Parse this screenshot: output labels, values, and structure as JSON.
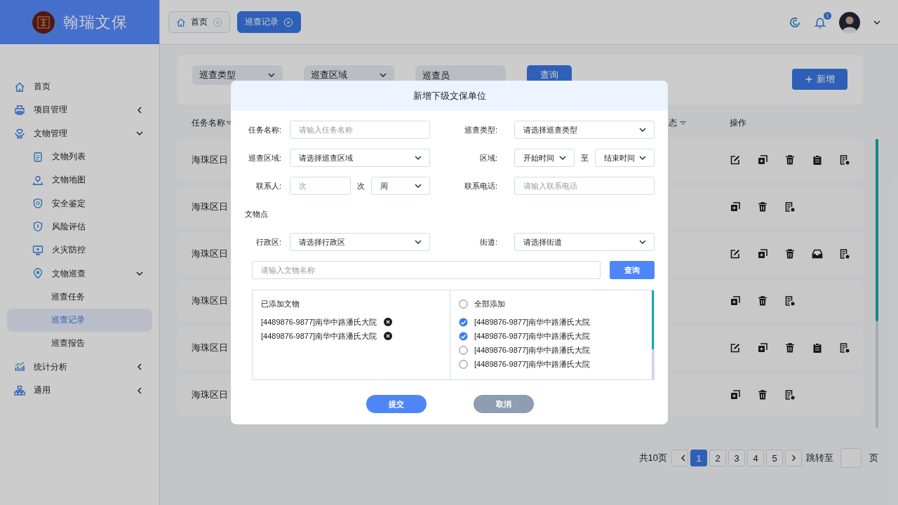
{
  "brand": {
    "name": "翰瑞文保"
  },
  "sidebar": {
    "items": [
      {
        "label": "首页",
        "selected": false
      },
      {
        "label": "项目管理",
        "selected": false,
        "expanded": false
      },
      {
        "label": "文物管理",
        "selected": false,
        "expanded": true,
        "children": [
          {
            "label": "文物列表",
            "selected": false
          },
          {
            "label": "文物地图",
            "selected": false
          },
          {
            "label": "安全鉴定",
            "selected": false
          },
          {
            "label": "风险评估",
            "selected": false
          },
          {
            "label": "火灾防控",
            "selected": false
          },
          {
            "label": "文物巡查",
            "selected": false,
            "expanded": true,
            "children": [
              {
                "label": "巡查任务",
                "selected": false
              },
              {
                "label": "巡查记录",
                "selected": true
              },
              {
                "label": "巡查报告",
                "selected": false
              }
            ]
          }
        ]
      },
      {
        "label": "统计分析",
        "selected": false,
        "expanded": false
      },
      {
        "label": "通用",
        "selected": false,
        "expanded": false
      }
    ]
  },
  "tabs": [
    {
      "label": "首页",
      "selected": false
    },
    {
      "label": "巡查记录",
      "selected": true
    }
  ],
  "header": {
    "notification_count": "1"
  },
  "filters": [
    {
      "kind": "select",
      "label": "巡查类型"
    },
    {
      "kind": "select",
      "label": "巡查区域"
    },
    {
      "kind": "input",
      "placeholder": "巡查员"
    }
  ],
  "query_button": "查询",
  "add_button": "新增",
  "table": {
    "columns": [
      {
        "label": "任务名称",
        "sortable": true
      },
      {
        "label": "态",
        "sortable": true
      },
      {
        "label": "操作",
        "sortable": false
      }
    ],
    "rows": [
      {
        "task_name": "海珠区日",
        "actions": [
          {
            "kind": "edit"
          },
          {
            "kind": "copy"
          },
          {
            "kind": "delete"
          },
          {
            "kind": "clipboard"
          },
          {
            "kind": "report"
          }
        ]
      },
      {
        "task_name": "海珠区日",
        "actions": [
          {
            "kind": "copy"
          },
          {
            "kind": "delete"
          },
          {
            "kind": "report"
          }
        ]
      },
      {
        "task_name": "海珠区日",
        "actions": [
          {
            "kind": "edit"
          },
          {
            "kind": "copy"
          },
          {
            "kind": "delete"
          },
          {
            "kind": "inbox"
          },
          {
            "kind": "report"
          }
        ]
      },
      {
        "task_name": "海珠区日",
        "actions": [
          {
            "kind": "copy"
          },
          {
            "kind": "delete"
          },
          {
            "kind": "report"
          }
        ]
      },
      {
        "task_name": "海珠区日",
        "actions": [
          {
            "kind": "edit"
          },
          {
            "kind": "copy"
          },
          {
            "kind": "delete"
          },
          {
            "kind": "clipboard"
          },
          {
            "kind": "report"
          }
        ]
      },
      {
        "task_name": "海珠区日",
        "actions": [
          {
            "kind": "copy"
          },
          {
            "kind": "delete"
          },
          {
            "kind": "report"
          }
        ]
      }
    ]
  },
  "pagination": {
    "total": "共10页",
    "pages": [
      {
        "label": "1",
        "selected": true
      },
      {
        "label": "2",
        "selected": false
      },
      {
        "label": "3",
        "selected": false
      },
      {
        "label": "4",
        "selected": false
      },
      {
        "label": "5",
        "selected": false
      }
    ],
    "jump_label": "跳转至",
    "suffix": "页"
  },
  "dialog": {
    "title": "新增下级文保单位",
    "form_rows": [
      {
        "kind": "fields",
        "fields": [
          {
            "label": "任务名称:",
            "controls": [
              {
                "kind": "input",
                "placeholder": "请输入任务名称"
              }
            ]
          },
          {
            "label": "巡查类型:",
            "controls": [
              {
                "kind": "select",
                "value": "请选择巡查类型"
              }
            ]
          }
        ]
      },
      {
        "kind": "fields",
        "fields": [
          {
            "label": "巡查区域:",
            "controls": [
              {
                "kind": "select",
                "value": "请选择巡查区域"
              }
            ]
          },
          {
            "label": "区域:",
            "controls": [
              {
                "kind": "select",
                "value": "开始时间"
              },
              {
                "kind": "text",
                "text": "至"
              },
              {
                "kind": "select",
                "value": "结束时间"
              }
            ]
          }
        ]
      },
      {
        "kind": "fields",
        "fields": [
          {
            "label": "联系人:",
            "controls": [
              {
                "kind": "input",
                "placeholder": "次"
              },
              {
                "kind": "text",
                "text": "次"
              },
              {
                "kind": "select",
                "value": "周"
              }
            ]
          },
          {
            "label": "联系电话:",
            "controls": [
              {
                "kind": "input",
                "placeholder": "请输入联系电话"
              }
            ]
          }
        ]
      },
      {
        "kind": "section",
        "title": "文物点"
      },
      {
        "kind": "fields",
        "fields": [
          {
            "label": "行政区:",
            "controls": [
              {
                "kind": "select",
                "value": "请选择行政区"
              }
            ]
          },
          {
            "label": "街道:",
            "controls": [
              {
                "kind": "select",
                "value": "请选择街道"
              }
            ]
          }
        ]
      }
    ],
    "search": {
      "placeholder": "请输入文物名称",
      "button": "查询"
    },
    "added": {
      "title": "已添加文物",
      "items": [
        "[4489876-9877]南华中路潘氏大院",
        "[4489876-9877]南华中路潘氏大院"
      ]
    },
    "available": {
      "select_all": {
        "label": "全部添加",
        "checked": false
      },
      "items": [
        {
          "label": "[4489876-9877]南华中路潘氏大院",
          "checked": true
        },
        {
          "label": "[4489876-9877]南华中路潘氏大院",
          "checked": true
        },
        {
          "label": "[4489876-9877]南华中路潘氏大院",
          "checked": false
        },
        {
          "label": "[4489876-9877]南华中路潘氏大院",
          "checked": false
        }
      ]
    },
    "buttons": [
      {
        "label": "提交",
        "kind": "primary"
      },
      {
        "label": "取消",
        "kind": "secondary"
      }
    ]
  }
}
